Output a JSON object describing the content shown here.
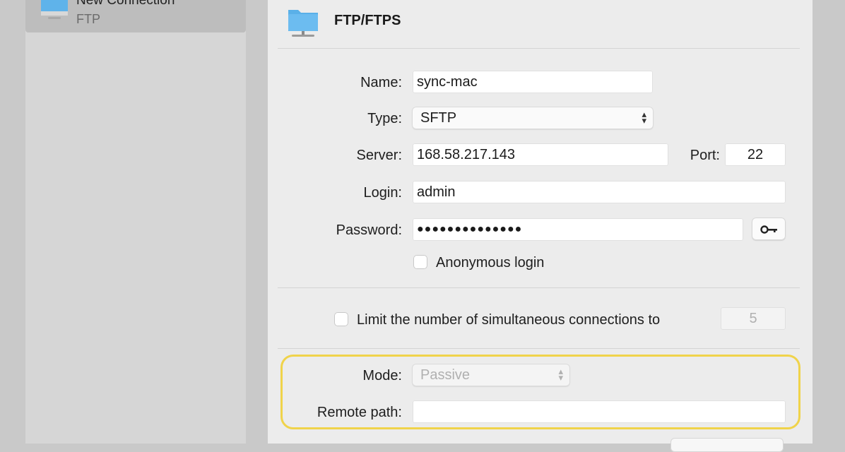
{
  "sidebar": {
    "selected_item": {
      "title": "New Connection",
      "subtitle": "FTP",
      "icon": "monitor-icon"
    }
  },
  "header": {
    "title": "FTP/FTPS",
    "icon": "folder-network-icon"
  },
  "form": {
    "name": {
      "label": "Name:",
      "value": "sync-mac"
    },
    "type": {
      "label": "Type:",
      "value": "SFTP"
    },
    "server": {
      "label": "Server:",
      "value": "168.58.217.143"
    },
    "port": {
      "label": "Port:",
      "value": "22"
    },
    "login": {
      "label": "Login:",
      "value": "admin"
    },
    "password": {
      "label": "Password:",
      "value": "●●●●●●●●●●●●●●",
      "button_icon": "key-icon"
    },
    "anonymous": {
      "label": "Anonymous login",
      "checked": false
    }
  },
  "limit": {
    "label": "Limit the number of simultaneous connections to",
    "checked": false,
    "value": "5"
  },
  "advanced": {
    "mode": {
      "label": "Mode:",
      "value": "Passive"
    },
    "remote_path": {
      "label": "Remote path:",
      "value": ""
    }
  },
  "colors": {
    "highlight": "#f0d34a",
    "panel": "#ececec",
    "sidebar": "#d6d6d6"
  }
}
